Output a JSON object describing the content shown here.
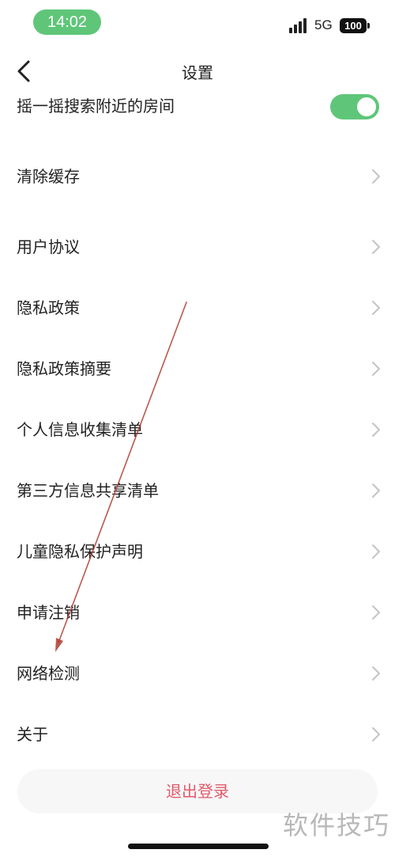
{
  "status_bar": {
    "time": "14:02",
    "network": "5G",
    "battery": "100"
  },
  "nav": {
    "title": "设置"
  },
  "shake_row": {
    "label": "摇一摇搜索附近的房间",
    "enabled": true
  },
  "menu": [
    {
      "label": "清除缓存"
    },
    {
      "label": "用户协议"
    },
    {
      "label": "隐私政策"
    },
    {
      "label": "隐私政策摘要"
    },
    {
      "label": "个人信息收集清单"
    },
    {
      "label": "第三方信息共享清单"
    },
    {
      "label": "儿童隐私保护声明"
    },
    {
      "label": "申请注销"
    },
    {
      "label": "网络检测"
    },
    {
      "label": "关于"
    }
  ],
  "logout": {
    "label": "退出登录"
  },
  "watermark": "软件技巧",
  "colors": {
    "accent": "#5fc679",
    "logout_text": "#e35a6b",
    "annotation_arrow": "#b03a2e"
  }
}
